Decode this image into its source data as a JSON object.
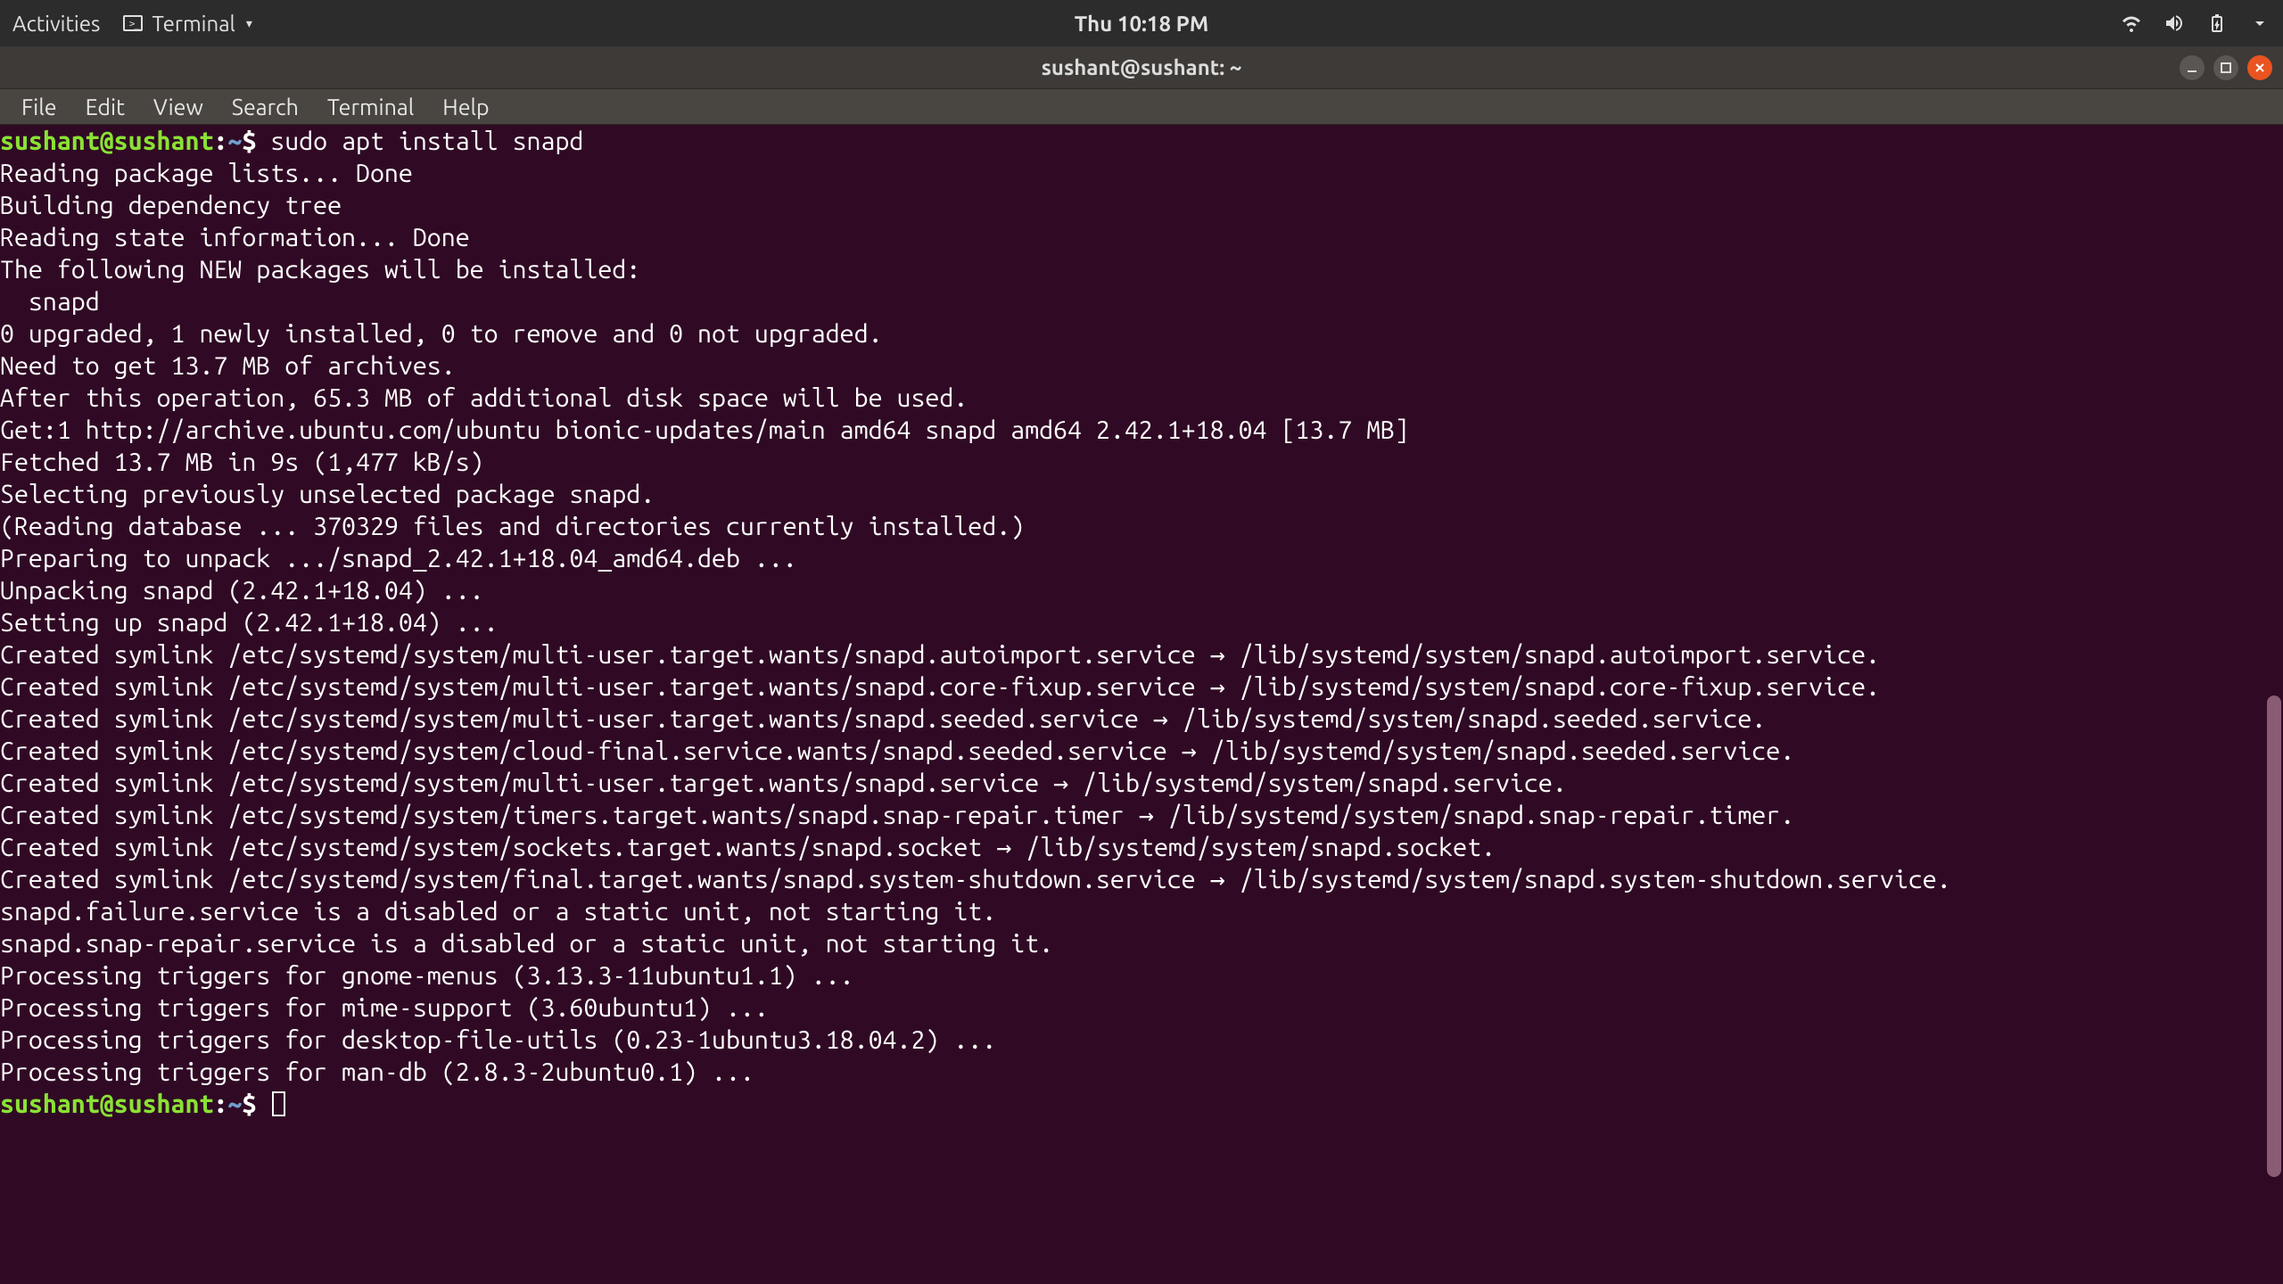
{
  "topbar": {
    "activities": "Activities",
    "appname": "Terminal",
    "clock": "Thu 10:18 PM"
  },
  "window": {
    "title": "sushant@sushant: ~"
  },
  "menu": {
    "file": "File",
    "edit": "Edit",
    "view": "View",
    "search": "Search",
    "terminal": "Terminal",
    "help": "Help"
  },
  "prompt": {
    "userhost": "sushant@sushant",
    "sep": ":",
    "path": "~",
    "dollar": "$ "
  },
  "command": "sudo apt install snapd",
  "output_lines": [
    "Reading package lists... Done",
    "Building dependency tree",
    "Reading state information... Done",
    "The following NEW packages will be installed:",
    "  snapd",
    "0 upgraded, 1 newly installed, 0 to remove and 0 not upgraded.",
    "Need to get 13.7 MB of archives.",
    "After this operation, 65.3 MB of additional disk space will be used.",
    "Get:1 http://archive.ubuntu.com/ubuntu bionic-updates/main amd64 snapd amd64 2.42.1+18.04 [13.7 MB]",
    "Fetched 13.7 MB in 9s (1,477 kB/s)",
    "Selecting previously unselected package snapd.",
    "(Reading database ... 370329 files and directories currently installed.)",
    "Preparing to unpack .../snapd_2.42.1+18.04_amd64.deb ...",
    "Unpacking snapd (2.42.1+18.04) ...",
    "Setting up snapd (2.42.1+18.04) ...",
    "Created symlink /etc/systemd/system/multi-user.target.wants/snapd.autoimport.service → /lib/systemd/system/snapd.autoimport.service.",
    "Created symlink /etc/systemd/system/multi-user.target.wants/snapd.core-fixup.service → /lib/systemd/system/snapd.core-fixup.service.",
    "Created symlink /etc/systemd/system/multi-user.target.wants/snapd.seeded.service → /lib/systemd/system/snapd.seeded.service.",
    "Created symlink /etc/systemd/system/cloud-final.service.wants/snapd.seeded.service → /lib/systemd/system/snapd.seeded.service.",
    "Created symlink /etc/systemd/system/multi-user.target.wants/snapd.service → /lib/systemd/system/snapd.service.",
    "Created symlink /etc/systemd/system/timers.target.wants/snapd.snap-repair.timer → /lib/systemd/system/snapd.snap-repair.timer.",
    "Created symlink /etc/systemd/system/sockets.target.wants/snapd.socket → /lib/systemd/system/snapd.socket.",
    "Created symlink /etc/systemd/system/final.target.wants/snapd.system-shutdown.service → /lib/systemd/system/snapd.system-shutdown.service.",
    "snapd.failure.service is a disabled or a static unit, not starting it.",
    "snapd.snap-repair.service is a disabled or a static unit, not starting it.",
    "Processing triggers for gnome-menus (3.13.3-11ubuntu1.1) ...",
    "Processing triggers for mime-support (3.60ubuntu1) ...",
    "Processing triggers for desktop-file-utils (0.23-1ubuntu3.18.04.2) ...",
    "Processing triggers for man-db (2.8.3-2ubuntu0.1) ..."
  ]
}
